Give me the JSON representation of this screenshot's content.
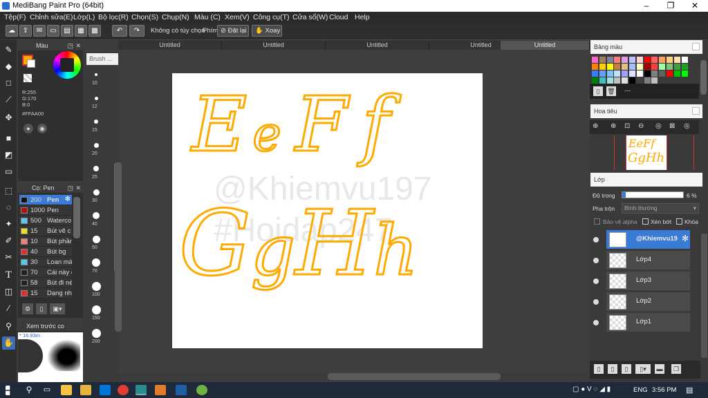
{
  "window": {
    "title": "MediBang Paint Pro (64bit)",
    "min": "–",
    "max": "❐",
    "close": "✕"
  },
  "menu": [
    "Tệp(F)",
    "Chỉnh sửa(E)",
    "Lớp(L)",
    "Bộ lọc(R)",
    "Chọn(S)",
    "Chụp(N)",
    "Màu (C)",
    "Xem(V)",
    "Công cụ(T)",
    "Cửa sổ(W)",
    "Cloud",
    "Help"
  ],
  "toolbar": {
    "no_option": "Không có tùy chọn",
    "keys_label": "Phím",
    "reset_label": "Đặt lại",
    "rotate_label": "Xoay"
  },
  "color_panel": {
    "title": "Màu",
    "r": "R:255",
    "g": "G:170",
    "b": "B:0",
    "hex": "#FFAA00",
    "primary": "#ffaa00"
  },
  "brush_panel": {
    "title": "Brush ...",
    "sizes": [
      "10",
      "12",
      "15",
      "20",
      "25",
      "30",
      "40",
      "50",
      "70",
      "100",
      "150",
      "200"
    ]
  },
  "pen_panel": {
    "title": "Cọ: Pen",
    "items": [
      {
        "size": "200",
        "name": "Pen",
        "color": "#111111"
      },
      {
        "size": "1000",
        "name": "Pen",
        "color": "#b01010"
      },
      {
        "size": "500",
        "name": "Waterco",
        "color": "#55c8f0"
      },
      {
        "size": "15",
        "name": "Bút vẽ c",
        "color": "#f2e020"
      },
      {
        "size": "10",
        "name": "Bút phần",
        "color": "#f08080"
      },
      {
        "size": "40",
        "name": "Bút bg",
        "color": "#e03030"
      },
      {
        "size": "30",
        "name": "Loan mà",
        "color": "#55c8f0"
      },
      {
        "size": "70",
        "name": "Cái này c",
        "color": "#222222"
      },
      {
        "size": "58",
        "name": "Bút đi nè",
        "color": "#222222"
      },
      {
        "size": "15",
        "name": "Dạng nh",
        "color": "#e03030"
      }
    ]
  },
  "preview_panel": {
    "title": "Xem trước co",
    "zoom": "* 16.93m"
  },
  "tabs": [
    "Untitled",
    "Untitled",
    "Untitled",
    "Untitled",
    "Untitled"
  ],
  "canvas": {
    "letters_row1": [
      "E",
      "e",
      "F",
      "f"
    ],
    "letters_row2": [
      "G",
      "g",
      "H",
      "h"
    ],
    "watermark1": "@Khiemvu197",
    "watermark2": "#Hoidap247",
    "ink_color": "#ffaa00"
  },
  "palette_panel": {
    "title": "Bảng màu",
    "status": "---"
  },
  "navigator_panel": {
    "title": "Hoa tiêu",
    "preview1": "EeFf",
    "preview2": "GgHh"
  },
  "layer_panel": {
    "title": "Lớp",
    "opacity_label": "Độ trong",
    "opacity_value": "6 %",
    "opacity_fraction": 0.06,
    "blend_label": "Pha trộn",
    "blend_value": "Bình thường",
    "protect_alpha": "Bảo vệ alpha",
    "clip": "Xén bớt",
    "lock": "Khóa",
    "layers": [
      {
        "name": "@Khiemvu19",
        "selected": true
      },
      {
        "name": "Lớp4",
        "selected": false
      },
      {
        "name": "Lớp3",
        "selected": false
      },
      {
        "name": "Lớp2",
        "selected": false
      },
      {
        "name": "Lớp1",
        "selected": false
      }
    ]
  },
  "taskbar": {
    "lang": "ENG",
    "time": "3:56 PM"
  }
}
